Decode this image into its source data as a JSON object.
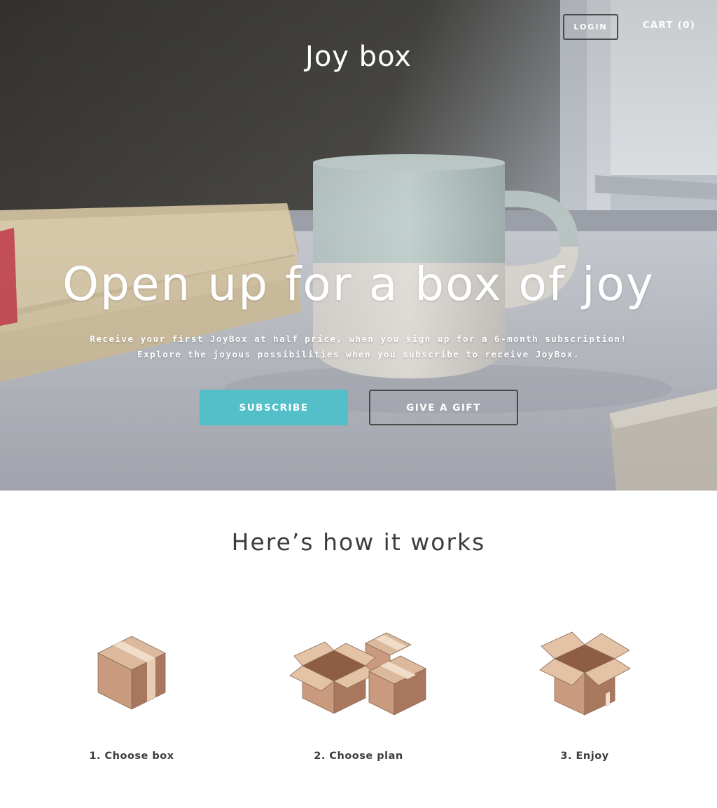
{
  "header": {
    "login_label": "LOGIN",
    "cart_label": "CART (0)",
    "site_title": "Joy box"
  },
  "hero": {
    "headline": "Open up for a box of joy",
    "subtext_line1": "Receive your first JoyBox at half price, when you sign up for a 6-month subscription!",
    "subtext_line2": "Explore the joyous possibilities when you subscribe to receive JoyBox.",
    "subscribe_label": "SUBSCRIBE",
    "gift_label": "GIVE A GIFT"
  },
  "how_it_works": {
    "title": "Here’s how it works",
    "steps": [
      {
        "label": "1. Choose box",
        "icon": "closed-box-icon"
      },
      {
        "label": "2. Choose plan",
        "icon": "multiple-boxes-icon"
      },
      {
        "label": "3. Enjoy",
        "icon": "open-box-icon"
      }
    ]
  },
  "colors": {
    "accent": "#52bfc9",
    "heading_text": "#3d3d3d",
    "box_tan": "#c89c7e",
    "box_tape": "#ecd8c2"
  }
}
